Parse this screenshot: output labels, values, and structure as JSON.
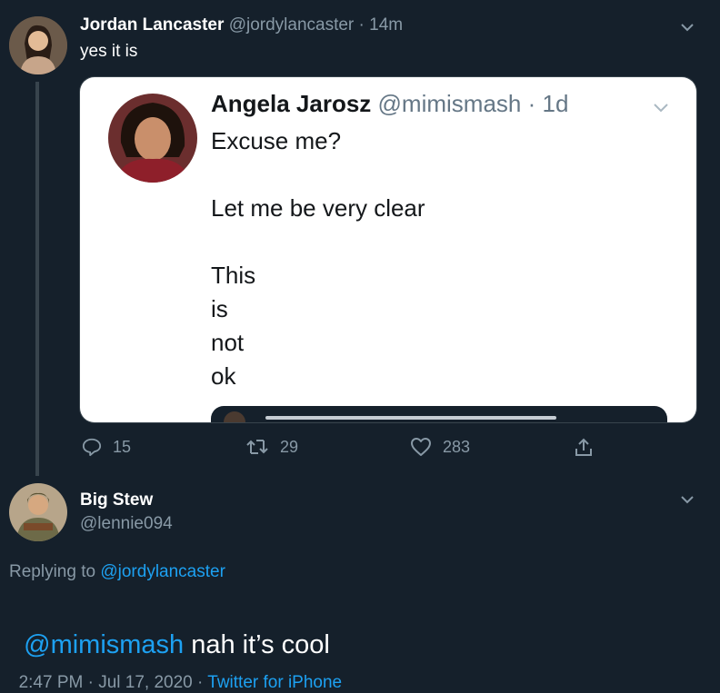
{
  "tweet1": {
    "name": "Jordan Lancaster",
    "handle": "@jordylancaster",
    "sep": "·",
    "time": "14m",
    "text": "yes it is",
    "quote": {
      "name": "Angela Jarosz",
      "handle": "@mimismash",
      "sep": "·",
      "time": "1d",
      "lines": [
        "Excuse me?",
        "Let me be very clear",
        "This",
        "is",
        "not",
        "ok"
      ]
    },
    "actions": {
      "replies": "15",
      "retweets": "29",
      "likes": "283"
    }
  },
  "tweet2": {
    "name": "Big Stew",
    "handle": "@lennie094",
    "replying_prefix": "Replying to",
    "replying_to": "@jordylancaster",
    "mention": "@mimismash",
    "text": " nah it’s cool",
    "time": "2:47 PM · Jul 17, 2020 · ",
    "source": "Twitter for iPhone"
  },
  "colors": {
    "background": "#15202b",
    "accent": "#1da1f2",
    "muted": "#8899a6"
  }
}
